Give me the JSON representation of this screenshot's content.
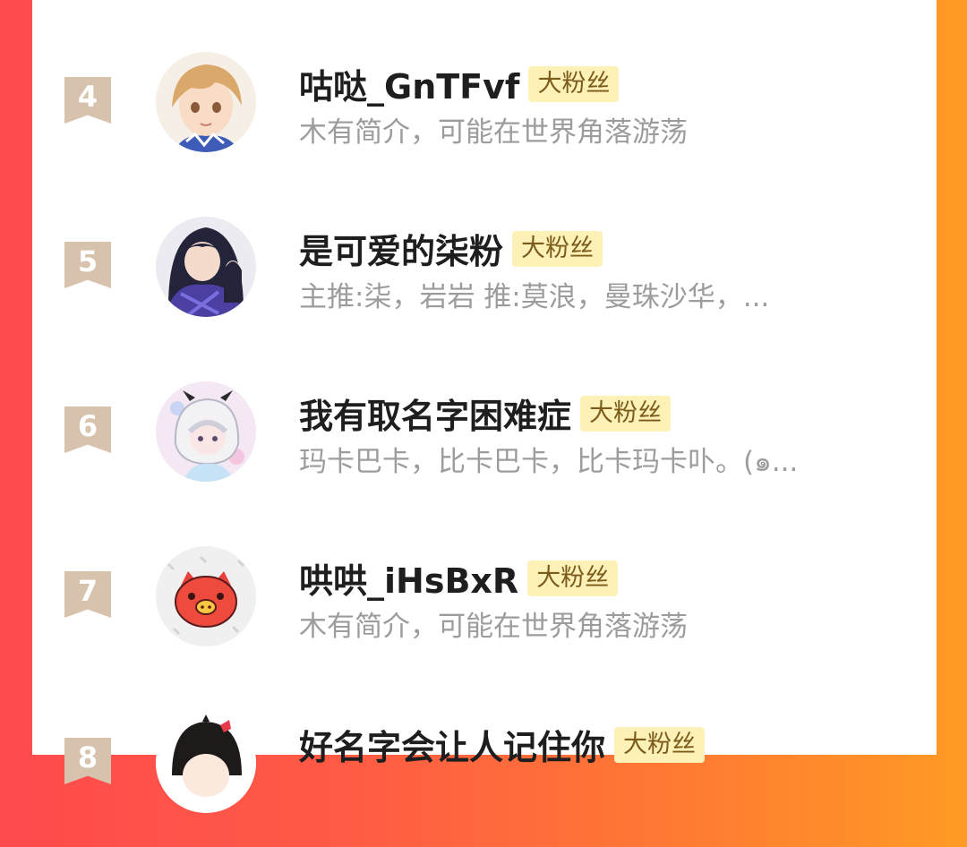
{
  "badge_label": "大粉丝",
  "fans": [
    {
      "rank": "4",
      "name": "咕哒_GnTFvf",
      "bio": "木有简介，可能在世界角落游荡",
      "avatar_icon": "anime-boy-avatar-icon"
    },
    {
      "rank": "5",
      "name": "是可爱的柒粉",
      "bio": "主推:柒，岩岩 推:莫浪，曼珠沙华，...",
      "avatar_icon": "dark-hair-girl-avatar-icon"
    },
    {
      "rank": "6",
      "name": "我有取名字困难症",
      "bio": "玛卡巴卡，比卡巴卡，比卡玛卡卟。(๑...",
      "avatar_icon": "white-hair-chibi-avatar-icon"
    },
    {
      "rank": "7",
      "name": "哄哄_iHsBxR",
      "bio": "木有简介，可能在世界角落游荡",
      "avatar_icon": "red-pig-avatar-icon"
    },
    {
      "rank": "8",
      "name": "好名字会让人记住你",
      "bio": "",
      "avatar_icon": "black-hair-chibi-avatar-icon"
    }
  ],
  "colors": {
    "background_left": "#ff4a4e",
    "background_right": "#ff9a24",
    "badge_bg": "#fdf1b8",
    "badge_text": "#7a5b1a",
    "rank_ribbon": "#d7c3ad",
    "name_text": "#1e1e1e",
    "bio_text": "#9c9c9c"
  }
}
